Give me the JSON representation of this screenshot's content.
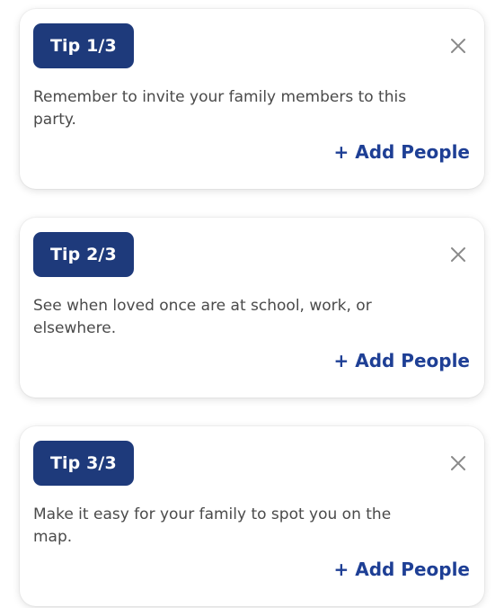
{
  "tips": [
    {
      "badge": "Tip 1/3",
      "message": "Remember to invite your family members to this party.",
      "action_label": "+ Add People"
    },
    {
      "badge": "Tip 2/3",
      "message": "See when loved once are at school, work, or elsewhere.",
      "action_label": "+ Add People"
    },
    {
      "badge": "Tip 3/3",
      "message": "Make it easy for your family to spot you on the map.",
      "action_label": "+ Add People"
    }
  ],
  "colors": {
    "badge_background": "#1e3a7b",
    "badge_text": "#ffffff",
    "action_text": "#1e3f95",
    "message_text": "#4a4a4a",
    "close_icon": "#8a8a8a"
  },
  "icons": {
    "close": "close-icon"
  }
}
